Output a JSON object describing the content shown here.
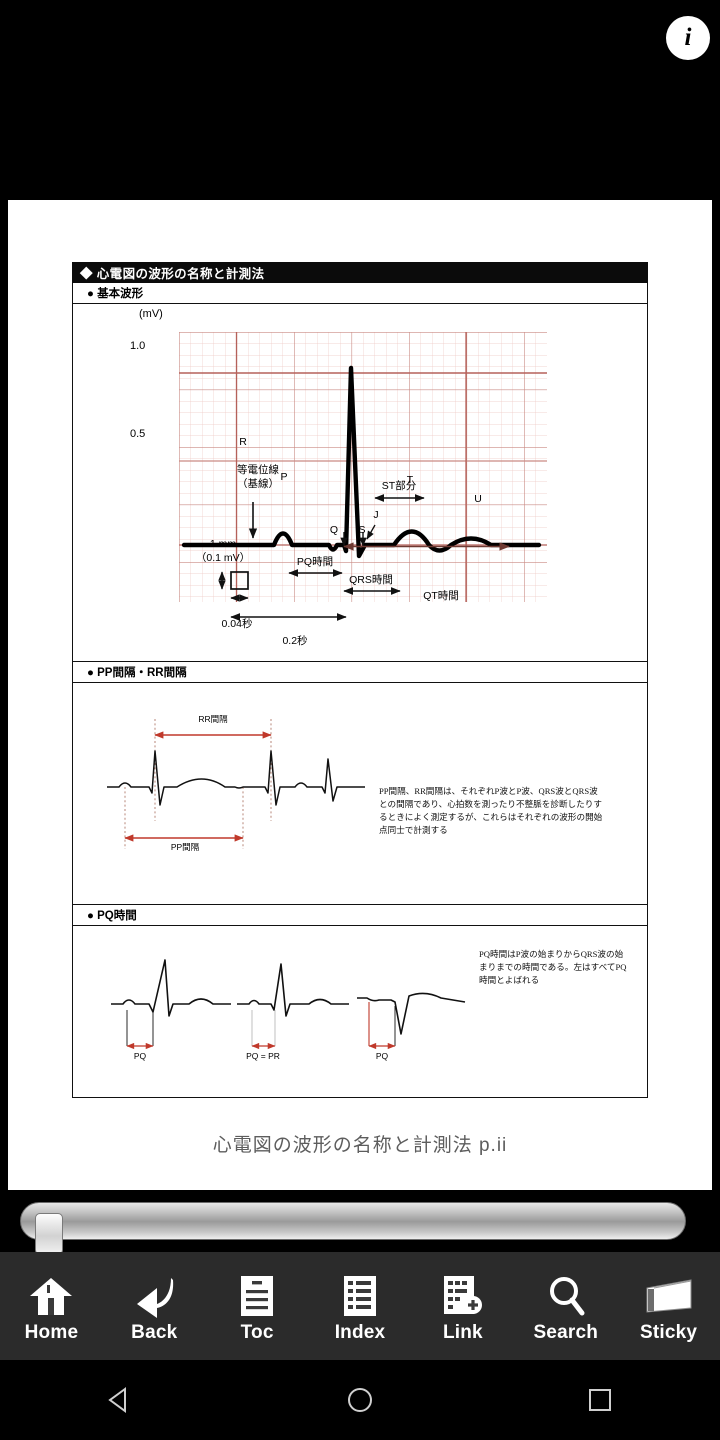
{
  "top_bar": {
    "info_label": "i"
  },
  "document": {
    "title_band": "◆ 心電図の波形の名称と計測法",
    "caption": "心電図の波形の名称と計測法 p.ii",
    "sections": [
      {
        "heading": "● 基本波形"
      },
      {
        "heading": "● PP間隔・RR間隔",
        "paragraph": "PP間隔、RR間隔は、それぞれP波とP波、QRS波とQRS波との間隔であり、心拍数を測ったり不整脈を診断したりするときによく測定するが、これらはそれぞれの波形の開始点同士で計測する"
      },
      {
        "heading": "● PQ時間",
        "paragraph": "PQ時間はP波の始まりからQRS波の始まりまでの時間である。左はすべてPQ時間とよばれる"
      }
    ]
  },
  "figure_basic": {
    "axis_unit": "(mV)",
    "y_ticks": [
      "1.0",
      "0.5"
    ],
    "wave_labels": [
      "P",
      "R",
      "Q",
      "S",
      "J",
      "T",
      "U"
    ],
    "baseline_label_line1": "等電位線",
    "baseline_label_line2": "（基線）",
    "calibration_line1": "1 mm",
    "calibration_line2": "（0.1 mV）",
    "interval_labels": [
      "ST部分",
      "PQ時間",
      "QRS時間",
      "QT時間"
    ],
    "time_labels": [
      "0.04秒",
      "0.2秒"
    ],
    "grid_color": "#e6b3ae",
    "trace_color": "#000000"
  },
  "figure_intervals": {
    "top_label": "RR間隔",
    "bottom_label": "PP間隔",
    "arrow_color": "#c0392b"
  },
  "figure_pq": {
    "labels": [
      "PQ",
      "PQ = PR",
      "PQ"
    ],
    "arrow_color": "#c0392b"
  },
  "page_slider": {
    "value": 0
  },
  "toolbar": {
    "items": [
      {
        "label": "Home",
        "icon": "home-icon"
      },
      {
        "label": "Back",
        "icon": "back-arrow-icon"
      },
      {
        "label": "Toc",
        "icon": "document-lines-icon"
      },
      {
        "label": "Index",
        "icon": "index-list-icon"
      },
      {
        "label": "Link",
        "icon": "link-add-icon"
      },
      {
        "label": "Search",
        "icon": "magnifier-icon"
      },
      {
        "label": "Sticky",
        "icon": "sticky-note-icon"
      }
    ]
  },
  "nav_bar": {
    "items": [
      {
        "name": "android-back",
        "icon": "triangle-left-icon"
      },
      {
        "name": "android-home",
        "icon": "circle-icon"
      },
      {
        "name": "android-recents",
        "icon": "square-icon"
      }
    ]
  }
}
